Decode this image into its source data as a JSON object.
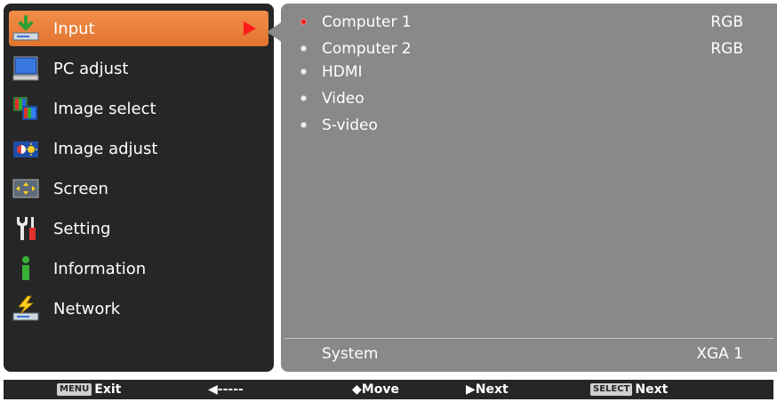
{
  "menu": {
    "items": [
      {
        "label": "Input",
        "icon": "input-icon",
        "selected": true
      },
      {
        "label": "PC adjust",
        "icon": "pc-adjust-icon"
      },
      {
        "label": "Image select",
        "icon": "image-select-icon"
      },
      {
        "label": "Image adjust",
        "icon": "image-adjust-icon"
      },
      {
        "label": "Screen",
        "icon": "screen-icon"
      },
      {
        "label": "Setting",
        "icon": "setting-icon"
      },
      {
        "label": "Information",
        "icon": "information-icon"
      },
      {
        "label": "Network",
        "icon": "network-icon"
      }
    ]
  },
  "submenu": {
    "items": [
      {
        "label": "Computer 1",
        "value": "RGB",
        "active": true
      },
      {
        "label": "Computer 2",
        "value": "RGB"
      },
      {
        "label": "HDMI",
        "value": ""
      },
      {
        "label": "Video",
        "value": ""
      },
      {
        "label": "S-video",
        "value": ""
      }
    ],
    "system": {
      "label": "System",
      "value": "XGA 1"
    }
  },
  "bottom_bar": {
    "menu_key": "MENU",
    "exit_label": "Exit",
    "back_label": "◀-----",
    "move_label": "◆Move",
    "next_label": "▶Next",
    "select_key": "SELECT",
    "select_next_label": "Next"
  },
  "colors": {
    "accent": "#e97f3b",
    "panel_dark": "#262626",
    "panel_gray": "#898989",
    "active_dot": "#e02020",
    "selection_arrow": "#ff1a1a"
  }
}
